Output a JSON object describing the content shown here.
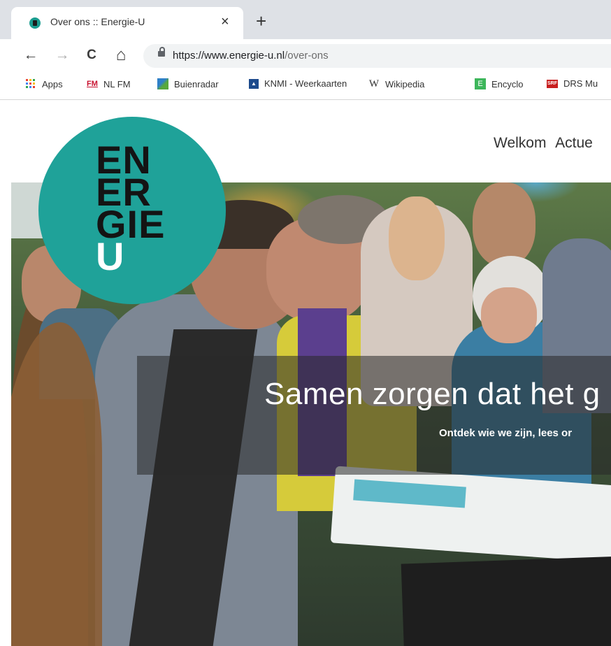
{
  "browser": {
    "tab": {
      "title": "Over ons :: Energie-U"
    },
    "new_tab_glyph": "+",
    "close_glyph": "×",
    "nav": {
      "back": "←",
      "forward": "→",
      "reload": "C",
      "home": "⌂"
    },
    "address": {
      "host": "https://www.energie-u.nl",
      "path": "/over-ons"
    },
    "bookmarks": [
      {
        "label": "Apps",
        "icon": "apps-grid-icon"
      },
      {
        "label": "NL FM",
        "icon": "fm-icon"
      },
      {
        "label": "Buienradar",
        "icon": "buienradar-icon"
      },
      {
        "label": "KNMI - Weerkaarten",
        "icon": "knmi-icon"
      },
      {
        "label": "Wikipedia",
        "icon": "wikipedia-icon"
      },
      {
        "label": "Encyclo",
        "icon": "encyclo-icon"
      },
      {
        "label": "DRS Mu",
        "icon": "srf-icon"
      }
    ],
    "bookmark_icon_text": {
      "fm": "FM",
      "wiki": "W",
      "encyclo": "E",
      "srf": "SRF",
      "knmi": "▲"
    }
  },
  "site": {
    "logo": {
      "lines": [
        "EN",
        "ER",
        "GIE"
      ],
      "last_line": "U",
      "color": "#1fa299"
    },
    "nav": [
      "Welkom",
      "Actue"
    ],
    "hero": {
      "headline": "Samen zorgen dat het g",
      "subline": "Ontdek wie we zijn, lees or"
    }
  }
}
